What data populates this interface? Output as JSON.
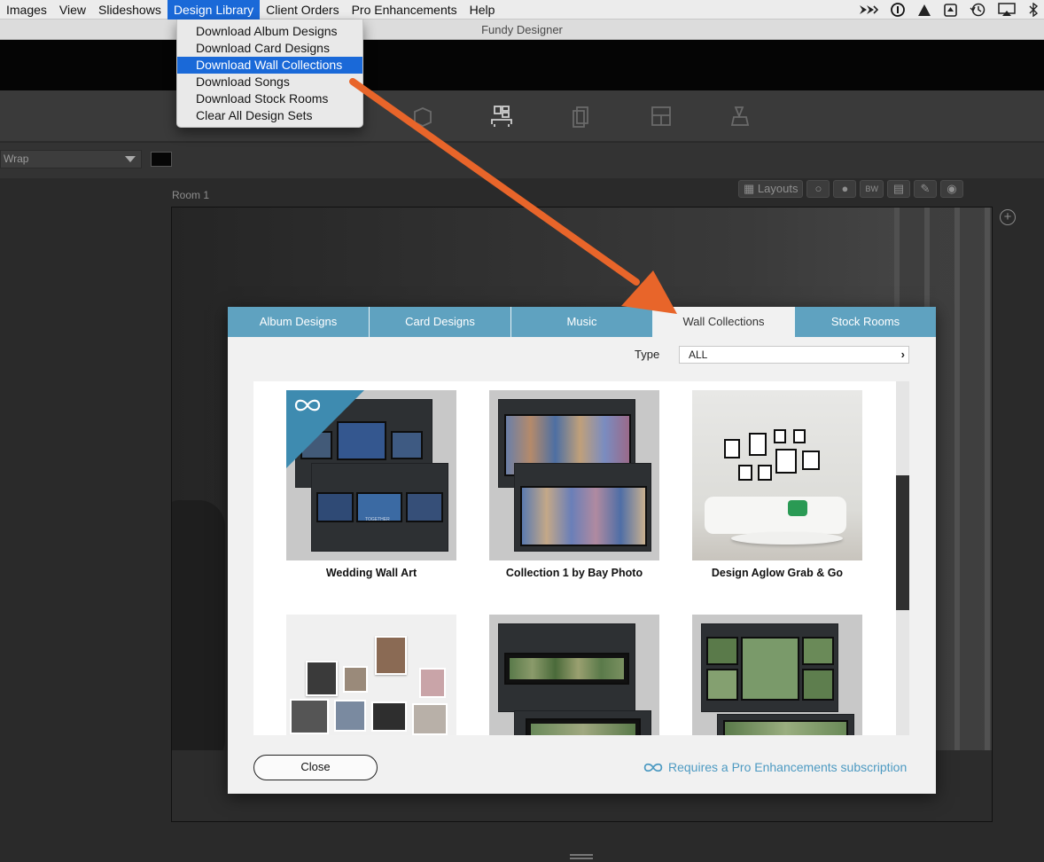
{
  "menubar": {
    "items": [
      "Images",
      "View",
      "Slideshows",
      "Design Library",
      "Client Orders",
      "Pro Enhancements",
      "Help"
    ],
    "active_index": 3,
    "status_icons": [
      "arrows-icon",
      "info-icon",
      "drive-icon",
      "upload-icon",
      "time-machine-icon",
      "airplay-icon",
      "bluetooth-icon"
    ]
  },
  "window": {
    "title": "Fundy Designer"
  },
  "dropdown": {
    "items": [
      "Download Album Designs",
      "Download Card Designs",
      "Download Wall Collections",
      "Download Songs",
      "Download Stock Rooms",
      "Clear All Design Sets"
    ],
    "highlighted_index": 2
  },
  "workspace": {
    "wrap_select": "Wrap",
    "room_label": "Room 1",
    "tools": {
      "layouts": "Layouts",
      "bw": "BW"
    }
  },
  "dialog": {
    "tabs": [
      "Album Designs",
      "Card Designs",
      "Music",
      "Wall Collections",
      "Stock Rooms"
    ],
    "active_tab": "Wall Collections",
    "type_label": "Type",
    "type_value": "ALL",
    "items": [
      {
        "title": "Wedding Wall Art",
        "pro": true
      },
      {
        "title": "Collection 1 by Bay Photo",
        "pro": false
      },
      {
        "title": "Design Aglow Grab & Go",
        "pro": false
      },
      {
        "title": "",
        "pro": false
      },
      {
        "title": "",
        "pro": false
      },
      {
        "title": "",
        "pro": false
      }
    ],
    "thumb_text": "TOGETHER",
    "close_label": "Close",
    "pro_note": "Requires a Pro Enhancements subscription"
  },
  "colors": {
    "accent": "#5fa2c0",
    "menu_highlight": "#1a69d8",
    "arrow": "#e8652a",
    "link": "#4d9ac2"
  }
}
